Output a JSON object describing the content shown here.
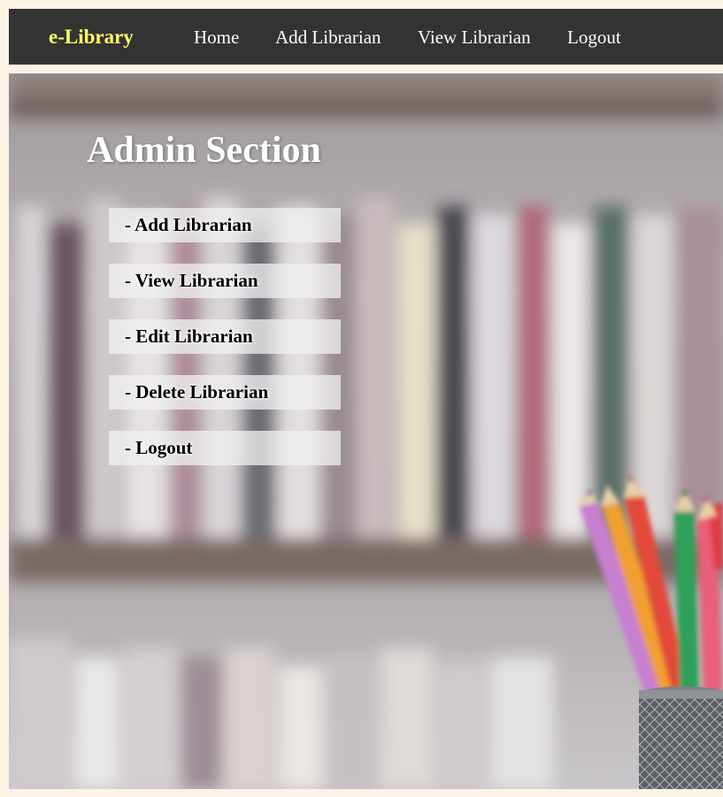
{
  "navbar": {
    "brand": "e-Library",
    "links": [
      "Home",
      "Add Librarian",
      "View Librarian",
      "Logout"
    ]
  },
  "main": {
    "title": "Admin Section",
    "menu": [
      "- Add Librarian",
      "- View Librarian",
      "- Edit Librarian",
      "- Delete Librarian",
      "- Logout"
    ]
  },
  "colors": {
    "page_bg": "#fbf3e6",
    "navbar_bg": "#333333",
    "brand": "#ffff66",
    "nav_text": "#ffffff"
  },
  "icons": {
    "background": "blurred-bookshelf-with-pencil-cup-image"
  }
}
